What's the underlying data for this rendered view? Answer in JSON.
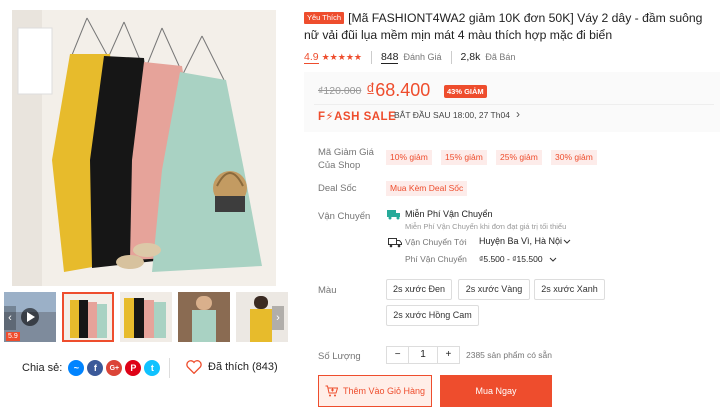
{
  "product": {
    "badge": "Yêu Thích",
    "title": "[Mã FASHIONT4WA2 giảm 10K đơn 50K] Váy 2 dây - đầm suông nữ vải đũi lụa mềm mịn mát 4 màu thích hợp mặc đi biển",
    "rating": "4.9",
    "stars": "★★★★★",
    "reviews_count": "848",
    "reviews_label": "Đánh Giá",
    "sold_count": "2,8k",
    "sold_label": "Đã Bán"
  },
  "price": {
    "old": "₫120.000",
    "new": "₫68.400",
    "discount": "43% GIẢM",
    "flash_logo": "F⚡ASH SALE",
    "flash_time": "BẮT ĐẦU SAU 18:00, 27 Th04",
    "flash_chevron": "›"
  },
  "vouchers": {
    "label": "Mã Giảm Giá Của Shop",
    "items": [
      "10% giảm",
      "15% giảm",
      "25% giảm",
      "30% giảm"
    ]
  },
  "deal": {
    "label": "Deal Sốc",
    "tag": "Mua Kèm Deal Sốc"
  },
  "shipping": {
    "label": "Vận Chuyển",
    "free_title": "Miễn Phí Vận Chuyển",
    "free_sub": "Miễn Phí Vận Chuyển khi đơn đạt giá trị tối thiểu",
    "to_label": "Vận Chuyển Tới",
    "to_value": "Huyện Ba Vì, Hà Nội",
    "fee_label": "Phí Vận Chuyển",
    "fee_value": "₫5.500 - ₫15.500"
  },
  "variants": {
    "label": "Màu",
    "options": [
      "2s xước Đen",
      "2s xước Vàng",
      "2s xước Xanh",
      "2s xước Hồng Cam"
    ]
  },
  "quantity": {
    "label": "Số Lượng",
    "minus": "−",
    "value": "1",
    "plus": "+",
    "stock": "2385 sản phẩm có sẵn"
  },
  "actions": {
    "add_to_cart": "Thêm Vào Giỏ Hàng",
    "buy_now": "Mua Ngay"
  },
  "gallery": {
    "video_badge": "5.9",
    "prev": "‹",
    "next": "›"
  },
  "share": {
    "label": "Chia sẻ:",
    "like_label": "Đã thích (843)"
  },
  "colors": {
    "accent": "#ee4d2d",
    "dress_yellow": "#e7bb2c",
    "dress_black": "#161616",
    "dress_pink": "#e6a39a",
    "dress_mint": "#a9d2c3"
  }
}
